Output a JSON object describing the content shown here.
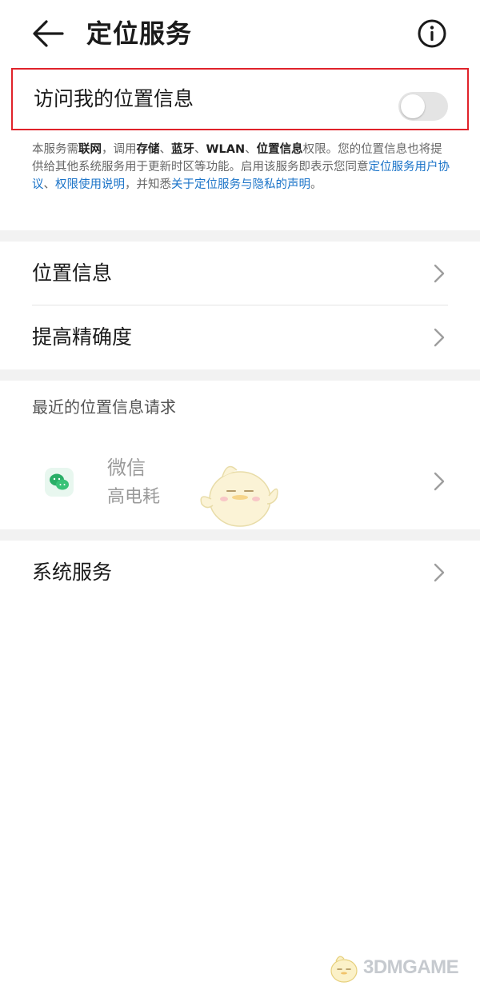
{
  "header": {
    "title": "定位服务"
  },
  "location_access": {
    "label": "访问我的位置信息",
    "enabled": false
  },
  "description": {
    "p1": "本服务需",
    "b1": "联网",
    "p2": "，调用",
    "b2": "存储",
    "p3": "、",
    "b3": "蓝牙",
    "p4": "、",
    "b4": "WLAN",
    "p5": "、",
    "b5": "位置信息",
    "p6": "权限。您的位置信息也将提供给其他系统服务用于更新时区等功能。启用该服务即表示您同意",
    "l1": "定位服务用户协议",
    "p7": "、",
    "l2": "权限使用说明",
    "p8": "，并知悉",
    "l3": "关于定位服务与隐私的声明",
    "p9": "。"
  },
  "menu": [
    {
      "label": "位置信息"
    },
    {
      "label": "提高精确度"
    }
  ],
  "recent_requests": {
    "title": "最近的位置信息请求",
    "apps": [
      {
        "name": "微信",
        "usage": "高电耗",
        "icon": "wechat-icon"
      }
    ]
  },
  "system_services": {
    "label": "系统服务"
  },
  "watermark": {
    "text": "3DMGAME"
  },
  "colors": {
    "link": "#1a73c8",
    "highlight_border": "#e0222a",
    "switch_off": "#e4e4e4"
  }
}
